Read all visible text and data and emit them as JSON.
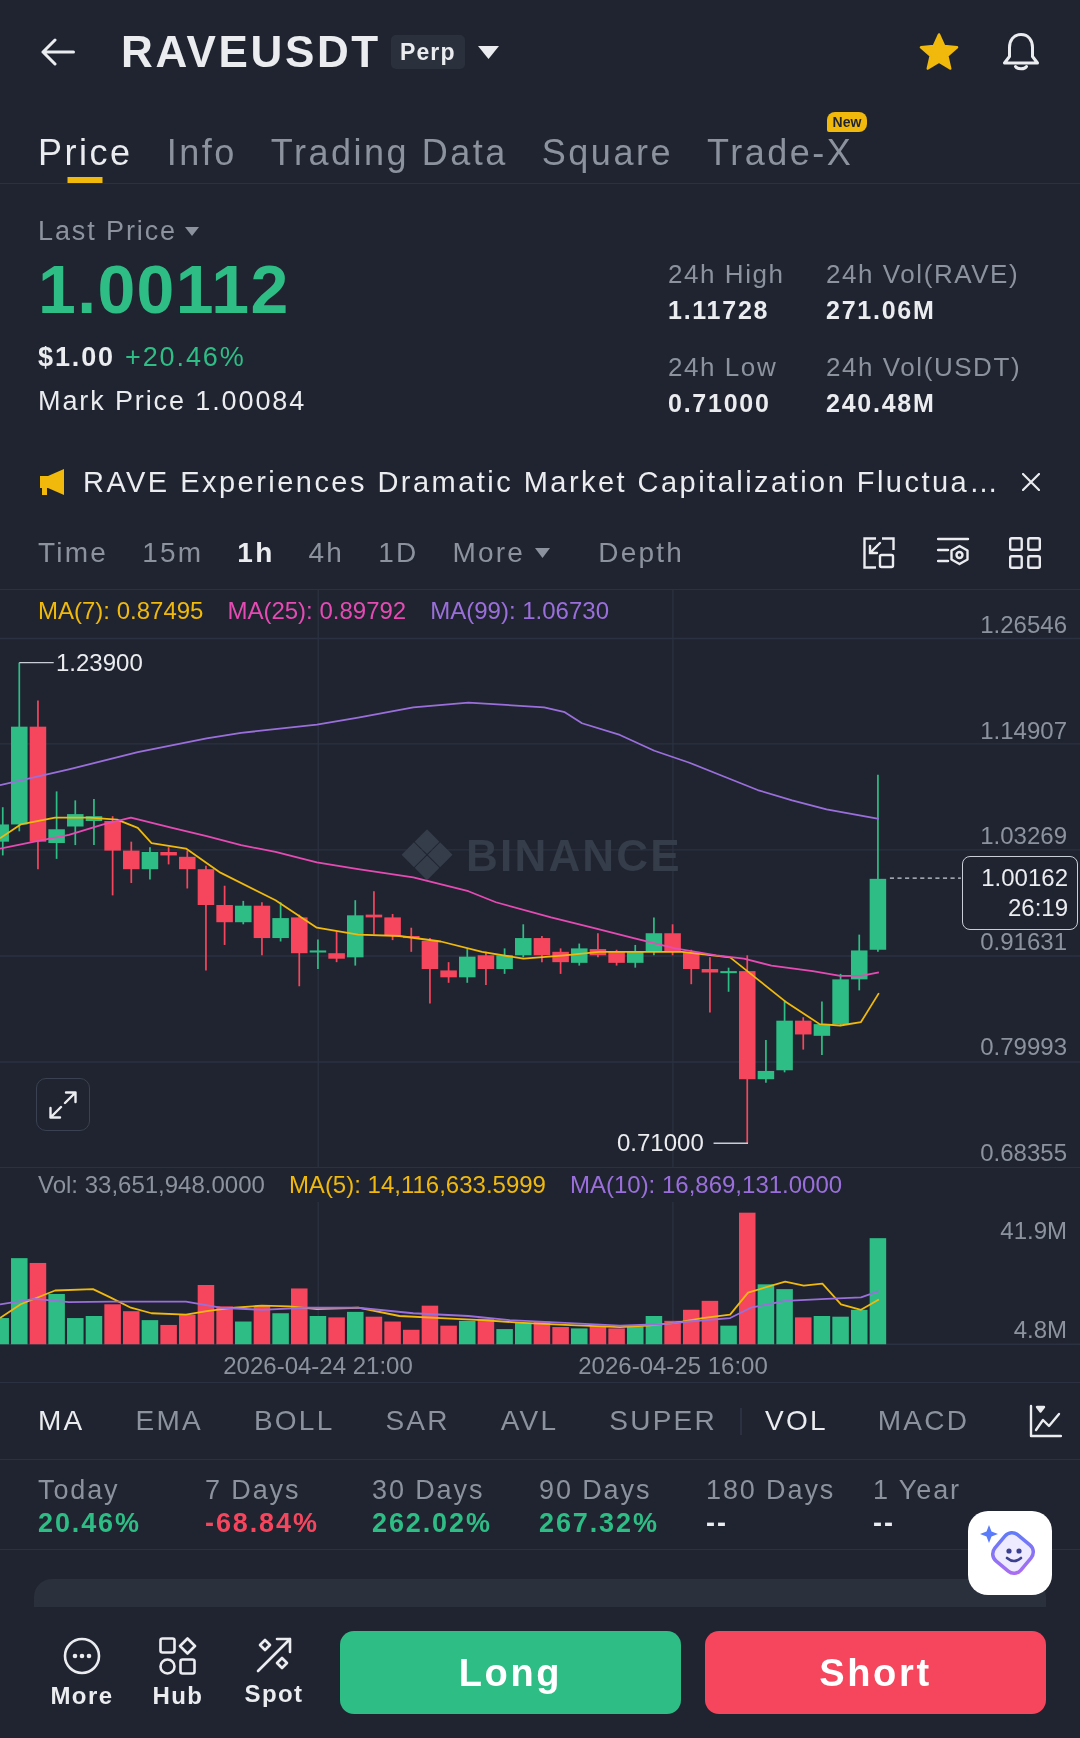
{
  "header": {
    "title": "RAVEUSDT",
    "badge": "Perp",
    "favorite": true
  },
  "tabs": [
    {
      "label": "Price",
      "selected": true
    },
    {
      "label": "Info",
      "selected": false
    },
    {
      "label": "Trading Data",
      "selected": false
    },
    {
      "label": "Square",
      "selected": false
    },
    {
      "label": "Trade-X",
      "selected": false,
      "badge": "New"
    }
  ],
  "price": {
    "label": "Last Price",
    "last": "1.00112",
    "usd": "$1.00",
    "change": "+20.46%",
    "mark": "Mark Price 1.00084"
  },
  "stats": [
    {
      "label": "24h High",
      "value": "1.11728"
    },
    {
      "label": "24h Vol(RAVE)",
      "value": "271.06M"
    },
    {
      "label": "24h Low",
      "value": "0.71000"
    },
    {
      "label": "24h Vol(USDT)",
      "value": "240.48M"
    }
  ],
  "news": {
    "text": "RAVE Experiences Dramatic Market Capitalization Fluctua…"
  },
  "intervals": [
    {
      "label": "Time",
      "kind": "option",
      "selected": false
    },
    {
      "label": "15m",
      "kind": "option",
      "selected": false
    },
    {
      "label": "1h",
      "kind": "option",
      "selected": true
    },
    {
      "label": "4h",
      "kind": "option",
      "selected": false
    },
    {
      "label": "1D",
      "kind": "option",
      "selected": false
    },
    {
      "label": "More",
      "kind": "dropdown",
      "selected": false
    },
    {
      "label": "Depth",
      "kind": "option",
      "selected": false
    }
  ],
  "chart": {
    "watermark": "BINANCE",
    "legend": [
      {
        "label": "MA(7): 0.87495",
        "color": "#f0b90b"
      },
      {
        "label": "MA(25): 0.89792",
        "color": "#e64bb4"
      },
      {
        "label": "MA(99): 1.06730",
        "color": "#9b6fdb"
      }
    ],
    "price_axis": [
      "1.26546",
      "1.14907",
      "1.03269",
      "0.91631",
      "0.79993",
      "0.68355"
    ],
    "high_marker": "1.23900",
    "low_marker": "0.71000",
    "price_tag": {
      "price": "1.00162",
      "countdown": "26:19"
    }
  },
  "volume": {
    "legend": [
      {
        "label": "Vol: 33,651,948.0000",
        "color": "#8c939f"
      },
      {
        "label": "MA(5): 14,116,633.5999",
        "color": "#f0b90b"
      },
      {
        "label": "MA(10): 16,869,131.0000",
        "color": "#9b6fdb"
      }
    ],
    "axis": [
      "41.9M",
      "4.8M"
    ],
    "time_axis": [
      "2026-04-24 21:00",
      "2026-04-25 16:00"
    ]
  },
  "main_indicators": [
    {
      "label": "MA",
      "selected": true
    },
    {
      "label": "EMA",
      "selected": false
    },
    {
      "label": "BOLL",
      "selected": false
    },
    {
      "label": "SAR",
      "selected": false
    },
    {
      "label": "AVL",
      "selected": false
    },
    {
      "label": "SUPER",
      "selected": false
    }
  ],
  "sub_indicators": [
    {
      "label": "VOL",
      "selected": true
    },
    {
      "label": "MACD",
      "selected": false
    }
  ],
  "performance": [
    {
      "period": "Today",
      "value": "20.46%",
      "color": "#2ebd85"
    },
    {
      "period": "7 Days",
      "value": "-68.84%",
      "color": "#f6465d"
    },
    {
      "period": "30 Days",
      "value": "262.02%",
      "color": "#2ebd85"
    },
    {
      "period": "90 Days",
      "value": "267.32%",
      "color": "#2ebd85"
    },
    {
      "period": "180 Days",
      "value": "--",
      "color": "#eaecef"
    },
    {
      "period": "1 Year",
      "value": "--",
      "color": "#eaecef"
    }
  ],
  "bottom_nav": [
    {
      "label": "More"
    },
    {
      "label": "Hub"
    },
    {
      "label": "Spot"
    }
  ],
  "actions": [
    {
      "label": "Long",
      "kind": "long"
    },
    {
      "label": "Short",
      "kind": "short"
    }
  ]
}
